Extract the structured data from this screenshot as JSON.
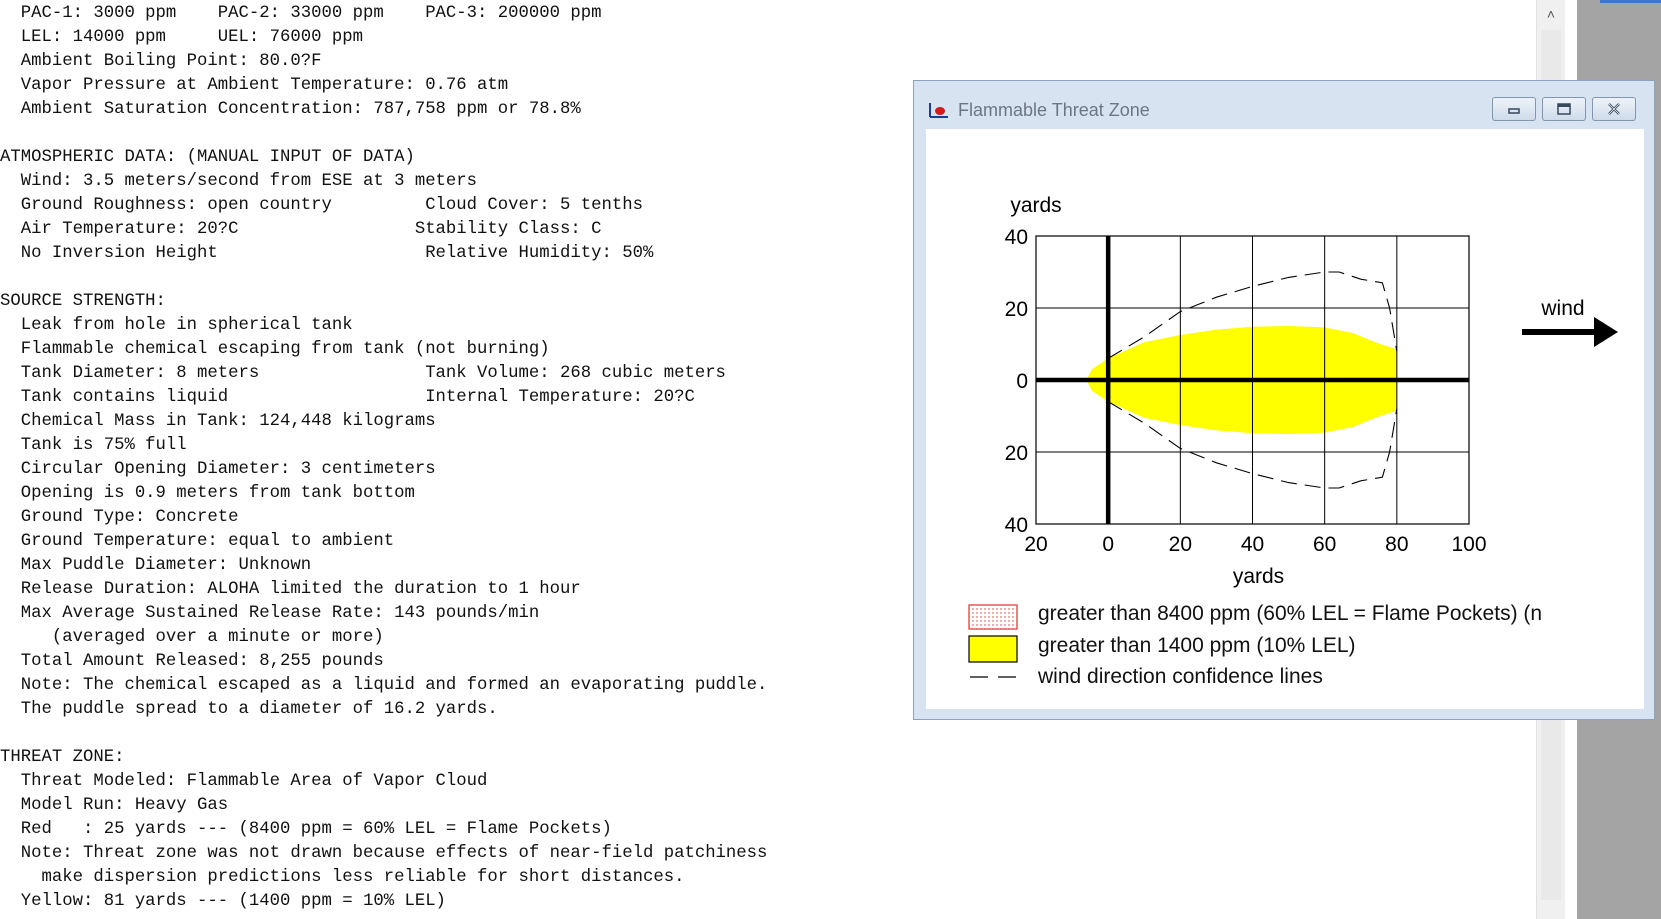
{
  "report_lines": [
    "  PAC-1: 3000 ppm    PAC-2: 33000 ppm    PAC-3: 200000 ppm",
    "  LEL: 14000 ppm     UEL: 76000 ppm",
    "  Ambient Boiling Point: 80.0?F",
    "  Vapor Pressure at Ambient Temperature: 0.76 atm",
    "  Ambient Saturation Concentration: 787,758 ppm or 78.8%",
    "",
    "ATMOSPHERIC DATA: (MANUAL INPUT OF DATA)",
    "  Wind: 3.5 meters/second from ESE at 3 meters",
    "  Ground Roughness: open country         Cloud Cover: 5 tenths",
    "  Air Temperature: 20?C                 Stability Class: C",
    "  No Inversion Height                    Relative Humidity: 50%",
    "",
    "SOURCE STRENGTH:",
    "  Leak from hole in spherical tank",
    "  Flammable chemical escaping from tank (not burning)",
    "  Tank Diameter: 8 meters                Tank Volume: 268 cubic meters",
    "  Tank contains liquid                   Internal Temperature: 20?C",
    "  Chemical Mass in Tank: 124,448 kilograms",
    "  Tank is 75% full",
    "  Circular Opening Diameter: 3 centimeters",
    "  Opening is 0.9 meters from tank bottom",
    "  Ground Type: Concrete",
    "  Ground Temperature: equal to ambient",
    "  Max Puddle Diameter: Unknown",
    "  Release Duration: ALOHA limited the duration to 1 hour",
    "  Max Average Sustained Release Rate: 143 pounds/min",
    "     (averaged over a minute or more)",
    "  Total Amount Released: 8,255 pounds",
    "  Note: The chemical escaped as a liquid and formed an evaporating puddle.",
    "  The puddle spread to a diameter of 16.2 yards.",
    "",
    "THREAT ZONE:",
    "  Threat Modeled: Flammable Area of Vapor Cloud",
    "  Model Run: Heavy Gas",
    "  Red   : 25 yards --- (8400 ppm = 60% LEL = Flame Pockets)",
    "  Note: Threat zone was not drawn because effects of near-field patchiness",
    "    make dispersion predictions less reliable for short distances.",
    "  Yellow: 81 yards --- (1400 ppm = 10% LEL)"
  ],
  "window": {
    "title": "Flammable Threat Zone",
    "icon": "threat-zone-app-icon",
    "buttons": [
      "minimize-icon",
      "maximize-icon",
      "close-icon"
    ]
  },
  "chart_data": {
    "type": "area",
    "x_unit_label": "yards",
    "y_unit_label": "yards",
    "xlim": [
      -20,
      100
    ],
    "ylim": [
      -40,
      40
    ],
    "x_ticks": [
      -20,
      0,
      20,
      40,
      60,
      80,
      100
    ],
    "x_tick_labels": [
      "20",
      "0",
      "20",
      "40",
      "60",
      "80",
      "100"
    ],
    "y_ticks": [
      40,
      20,
      0,
      -20,
      -40
    ],
    "y_tick_labels": [
      "40",
      "20",
      "0",
      "20",
      "40"
    ],
    "grid": true,
    "wind_label": "wind",
    "series": [
      {
        "name": "greater than 1400 ppm (10% LEL)",
        "color": "#ffff00",
        "upper": [
          [
            -6,
            0
          ],
          [
            -4.5,
            3
          ],
          [
            0,
            6
          ],
          [
            10,
            10.5
          ],
          [
            20,
            12.5
          ],
          [
            30,
            14
          ],
          [
            40,
            14.8
          ],
          [
            50,
            15
          ],
          [
            60,
            14.6
          ],
          [
            68,
            13
          ],
          [
            74,
            10.5
          ],
          [
            80,
            8.5
          ],
          [
            80,
            0
          ]
        ],
        "lower": [
          [
            -6,
            0
          ],
          [
            -4.5,
            -3
          ],
          [
            0,
            -6
          ],
          [
            10,
            -10.5
          ],
          [
            20,
            -12.5
          ],
          [
            30,
            -14
          ],
          [
            40,
            -14.8
          ],
          [
            50,
            -15
          ],
          [
            60,
            -14.6
          ],
          [
            68,
            -13
          ],
          [
            74,
            -10.5
          ],
          [
            80,
            -8.5
          ],
          [
            80,
            0
          ]
        ]
      },
      {
        "name": "greater than 8400 ppm (60% LEL = Flame Pockets) (n",
        "color": "#ff0000"
      }
    ],
    "confidence_lines": {
      "name": "wind direction confidence lines",
      "upper": [
        [
          0,
          6
        ],
        [
          10,
          12
        ],
        [
          20,
          19
        ],
        [
          30,
          23
        ],
        [
          40,
          26
        ],
        [
          50,
          28.5
        ],
        [
          60,
          30
        ],
        [
          64,
          30
        ],
        [
          70,
          28
        ],
        [
          76,
          27
        ],
        [
          78,
          20
        ],
        [
          80,
          8
        ]
      ],
      "lower": [
        [
          0,
          -6
        ],
        [
          10,
          -12
        ],
        [
          20,
          -19
        ],
        [
          30,
          -23
        ],
        [
          40,
          -26
        ],
        [
          50,
          -28.5
        ],
        [
          60,
          -30
        ],
        [
          64,
          -30
        ],
        [
          70,
          -28
        ],
        [
          76,
          -27
        ],
        [
          78,
          -20
        ],
        [
          80,
          -8
        ]
      ]
    }
  }
}
